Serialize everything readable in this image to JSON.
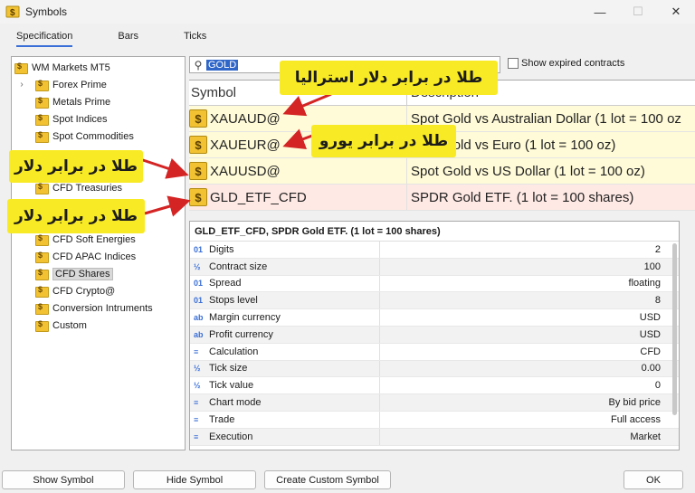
{
  "window": {
    "title": "Symbols"
  },
  "tabs": [
    "Specification",
    "Bars",
    "Ticks"
  ],
  "tree": {
    "root": "WM Markets MT5",
    "items": [
      "Forex Prime",
      "Metals Prime",
      "Spot Indices",
      "Spot Commodities",
      "CFD Treasuries",
      "CFD Soft Energies",
      "CFD APAC Indices",
      "CFD Shares",
      "CFD Crypto@",
      "Conversion Intruments",
      "Custom"
    ]
  },
  "search": {
    "value": "GOLD"
  },
  "show_expired": "Show expired contracts",
  "grid": {
    "headers": [
      "Symbol",
      "Description"
    ],
    "rows": [
      {
        "symbol": "XAUAUD@",
        "desc": "Spot Gold vs Australian Dollar (1 lot = 100 oz"
      },
      {
        "symbol": "XAUEUR@",
        "desc": "Spot Gold vs Euro (1 lot = 100 oz)"
      },
      {
        "symbol": "XAUUSD@",
        "desc": "Spot Gold vs US Dollar (1 lot = 100 oz)"
      },
      {
        "symbol": "GLD_ETF_CFD",
        "desc": "SPDR Gold ETF. (1 lot = 100 shares)"
      }
    ]
  },
  "details": {
    "header": "GLD_ETF_CFD, SPDR Gold ETF. (1 lot = 100 shares)",
    "rows": [
      {
        "icon": "01",
        "key": "Digits",
        "value": "2"
      },
      {
        "icon": "½",
        "key": "Contract size",
        "value": "100"
      },
      {
        "icon": "01",
        "key": "Spread",
        "value": "floating"
      },
      {
        "icon": "01",
        "key": "Stops level",
        "value": "8"
      },
      {
        "icon": "ab",
        "key": "Margin currency",
        "value": "USD"
      },
      {
        "icon": "ab",
        "key": "Profit currency",
        "value": "USD"
      },
      {
        "icon": "≡",
        "key": "Calculation",
        "value": "CFD"
      },
      {
        "icon": "½",
        "key": "Tick size",
        "value": "0.00"
      },
      {
        "icon": "½",
        "key": "Tick value",
        "value": "0"
      },
      {
        "icon": "≡",
        "key": "Chart mode",
        "value": "By bid price"
      },
      {
        "icon": "≡",
        "key": "Trade",
        "value": "Full access"
      },
      {
        "icon": "≡",
        "key": "Execution",
        "value": "Market"
      }
    ]
  },
  "buttons": {
    "show": "Show Symbol",
    "hide": "Hide Symbol",
    "create": "Create Custom Symbol",
    "ok": "OK"
  },
  "annotations": {
    "aud": "طلا در برابر دلار استرالیا",
    "eur": "طلا در برابر یورو",
    "usd1": "طلا در برابر دلار",
    "usd2": "طلا در برابر دلار"
  },
  "colors": {
    "annotation_bg": "#f8ea24",
    "arrow": "#d42424",
    "selection": "#2f66c8"
  }
}
